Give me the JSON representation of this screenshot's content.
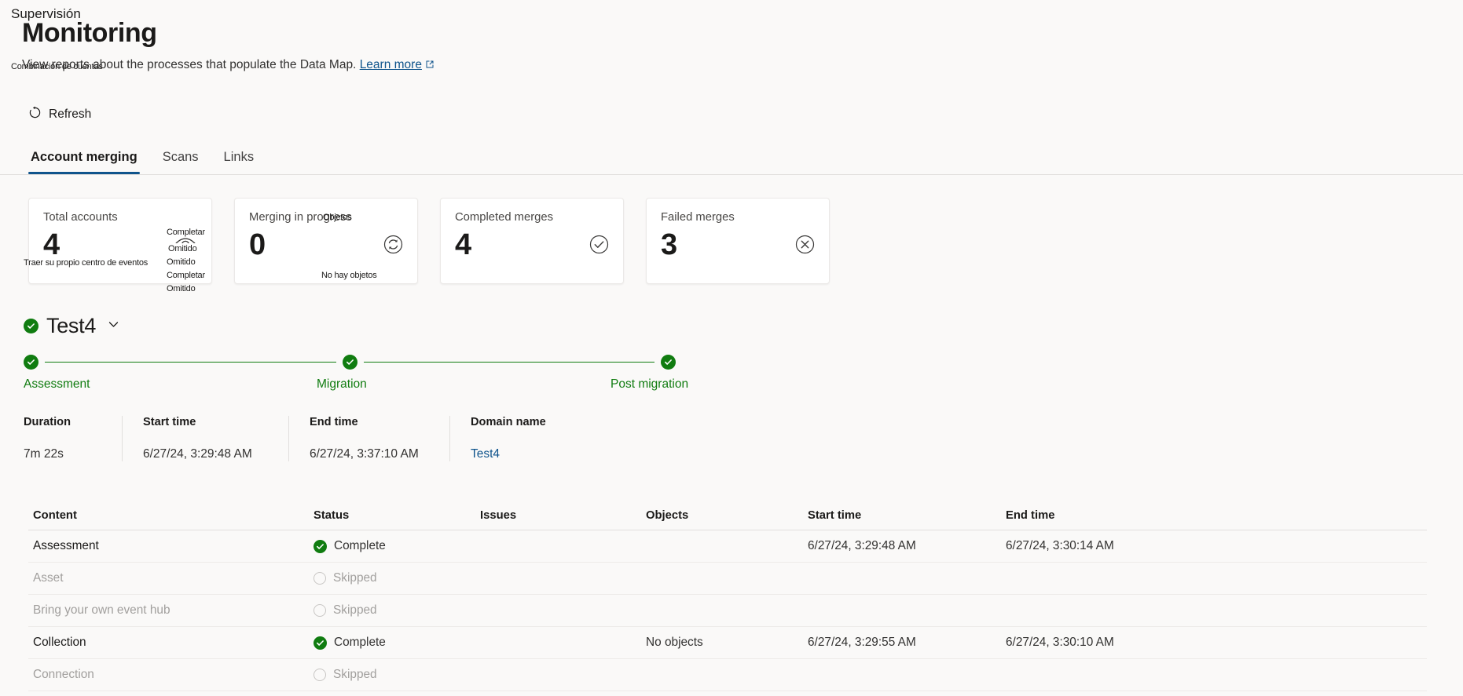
{
  "overlay": {
    "supervision": "Supervisión",
    "account_merging": "Combinación de cuentas",
    "eye_complete": "Completar",
    "status_list": [
      "Omitido",
      "Omitido",
      "Completar",
      "Omitido"
    ],
    "objects_label": "Objetos",
    "no_objects": "No hay objetos",
    "bring_own_event_hub": "Traer su propio centro de eventos"
  },
  "header": {
    "title": "Monitoring",
    "subtitle": "View reports about the processes that populate the Data Map.",
    "learn_more": "Learn more",
    "external_link_icon": "external-link-icon"
  },
  "commandbar": {
    "refresh_label": "Refresh",
    "refresh_icon": "refresh-icon"
  },
  "tabs": [
    {
      "label": "Account merging",
      "active": true
    },
    {
      "label": "Scans",
      "active": false
    },
    {
      "label": "Links",
      "active": false
    }
  ],
  "cards": [
    {
      "label": "Total accounts",
      "value": "4",
      "icon": "eye-icon"
    },
    {
      "label": "Merging in progress",
      "value": "0",
      "icon": "sync-icon"
    },
    {
      "label": "Completed merges",
      "value": "4",
      "icon": "check-circle-icon"
    },
    {
      "label": "Failed merges",
      "value": "3",
      "icon": "error-circle-icon"
    }
  ],
  "run": {
    "name": "Test4",
    "status_icon": "check-circle-filled-icon",
    "expand_icon": "chevron-down-icon"
  },
  "stepper": [
    {
      "label": "Assessment",
      "state": "complete"
    },
    {
      "label": "Migration",
      "state": "complete"
    },
    {
      "label": "Post migration",
      "state": "complete"
    }
  ],
  "details": [
    {
      "key": "Duration",
      "value": "7m 22s",
      "link": false
    },
    {
      "key": "Start time",
      "value": "6/27/24, 3:29:48 AM",
      "link": false
    },
    {
      "key": "End time",
      "value": "6/27/24, 3:37:10 AM",
      "link": false
    },
    {
      "key": "Domain name",
      "value": "Test4",
      "link": true
    }
  ],
  "table": {
    "columns": [
      "Content",
      "Status",
      "Issues",
      "Objects",
      "Start time",
      "End time"
    ],
    "rows": [
      {
        "content": "Assessment",
        "status": "Complete",
        "state": "complete",
        "issues": "",
        "objects": "",
        "start": "6/27/24, 3:29:48 AM",
        "end": "6/27/24, 3:30:14 AM"
      },
      {
        "content": "Asset",
        "status": "Skipped",
        "state": "skipped",
        "issues": "",
        "objects": "",
        "start": "",
        "end": ""
      },
      {
        "content": "Bring your own event hub",
        "status": "Skipped",
        "state": "skipped",
        "issues": "",
        "objects": "",
        "start": "",
        "end": ""
      },
      {
        "content": "Collection",
        "status": "Complete",
        "state": "complete",
        "issues": "",
        "objects": "No objects",
        "start": "6/27/24, 3:29:55 AM",
        "end": "6/27/24, 3:30:10 AM"
      },
      {
        "content": "Connection",
        "status": "Skipped",
        "state": "skipped",
        "issues": "",
        "objects": "",
        "start": "",
        "end": ""
      }
    ]
  },
  "colors": {
    "accent": "#0f548c",
    "success": "#107c10",
    "link": "#0f548c"
  }
}
